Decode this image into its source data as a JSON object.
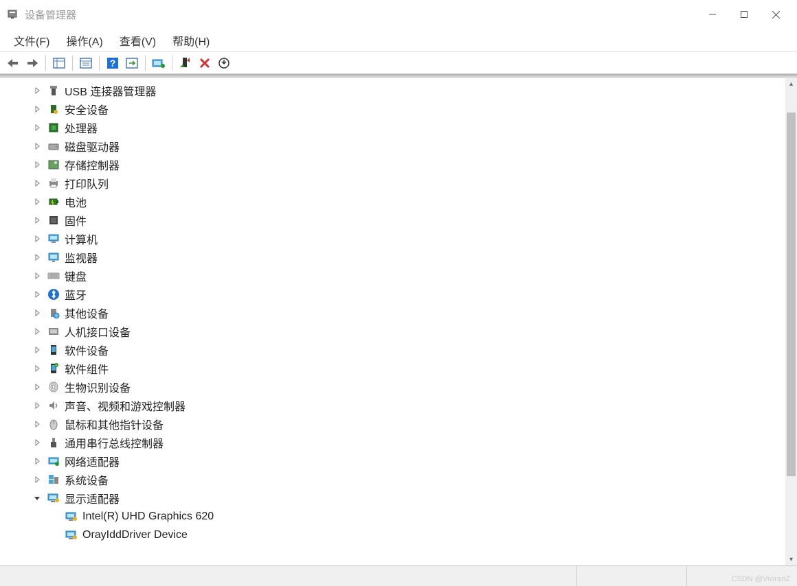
{
  "window": {
    "title": "设备管理器"
  },
  "menu": {
    "file": "文件(F)",
    "action": "操作(A)",
    "view": "查看(V)",
    "help": "帮助(H)"
  },
  "tree": {
    "items": [
      {
        "label": "USB 连接器管理器",
        "icon": "usb-connector",
        "expanded": false
      },
      {
        "label": "安全设备",
        "icon": "security",
        "expanded": false
      },
      {
        "label": "处理器",
        "icon": "cpu",
        "expanded": false
      },
      {
        "label": "磁盘驱动器",
        "icon": "disk",
        "expanded": false
      },
      {
        "label": "存储控制器",
        "icon": "storage",
        "expanded": false
      },
      {
        "label": "打印队列",
        "icon": "printer",
        "expanded": false
      },
      {
        "label": "电池",
        "icon": "battery",
        "expanded": false
      },
      {
        "label": "固件",
        "icon": "firmware",
        "expanded": false
      },
      {
        "label": "计算机",
        "icon": "computer",
        "expanded": false
      },
      {
        "label": "监视器",
        "icon": "monitor",
        "expanded": false
      },
      {
        "label": "键盘",
        "icon": "keyboard",
        "expanded": false
      },
      {
        "label": "蓝牙",
        "icon": "bluetooth",
        "expanded": false
      },
      {
        "label": "其他设备",
        "icon": "other",
        "expanded": false
      },
      {
        "label": "人机接口设备",
        "icon": "hid",
        "expanded": false
      },
      {
        "label": "软件设备",
        "icon": "software-device",
        "expanded": false
      },
      {
        "label": "软件组件",
        "icon": "software-component",
        "expanded": false
      },
      {
        "label": "生物识别设备",
        "icon": "biometric",
        "expanded": false
      },
      {
        "label": "声音、视频和游戏控制器",
        "icon": "sound",
        "expanded": false
      },
      {
        "label": "鼠标和其他指针设备",
        "icon": "mouse",
        "expanded": false
      },
      {
        "label": "通用串行总线控制器",
        "icon": "usb",
        "expanded": false
      },
      {
        "label": "网络适配器",
        "icon": "network",
        "expanded": false
      },
      {
        "label": "系统设备",
        "icon": "system",
        "expanded": false
      },
      {
        "label": "显示适配器",
        "icon": "display",
        "expanded": true,
        "children": [
          {
            "label": "Intel(R) UHD Graphics 620",
            "icon": "display-device"
          },
          {
            "label": "OrayIddDriver Device",
            "icon": "display-device"
          }
        ]
      }
    ]
  },
  "watermark": "CSDN @ViviranZ"
}
